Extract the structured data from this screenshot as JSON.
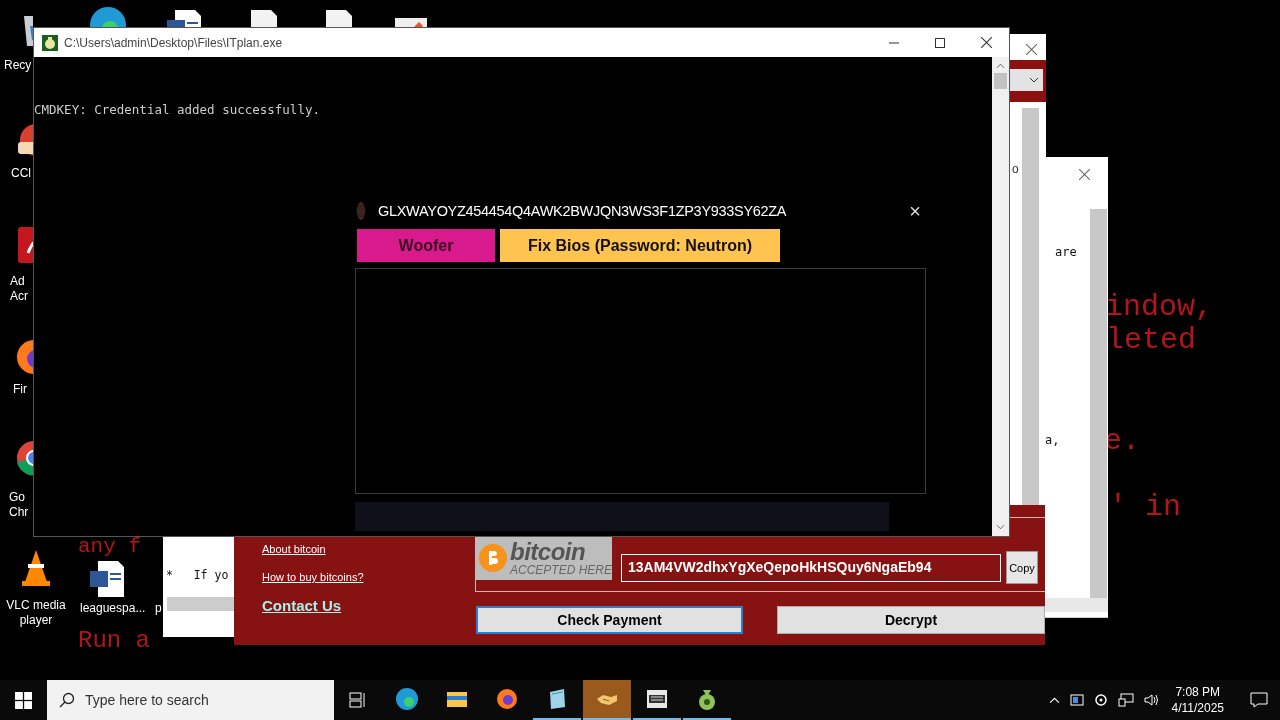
{
  "wallpaper_text": [
    "indow,",
    "leted",
    "e.",
    "' in",
    "any f",
    "Run a"
  ],
  "desktop_icons": [
    {
      "kind": "recycle",
      "lines": [
        "Recy"
      ]
    },
    {
      "kind": "ccleaner",
      "lines": [
        "CCl"
      ]
    },
    {
      "kind": "acrobat",
      "lines": [
        "Ad",
        "Acr"
      ]
    },
    {
      "kind": "firefox",
      "lines": [
        "Fir"
      ]
    },
    {
      "kind": "chrome",
      "lines": [
        "Go",
        "Chr"
      ]
    },
    {
      "kind": "vlc",
      "lines": [
        "VLC media",
        "player"
      ]
    },
    {
      "kind": "word",
      "lines": [
        "leaguespa..."
      ]
    },
    {
      "kind": "blank",
      "lines": [
        "p"
      ]
    },
    {
      "kind": "edge"
    },
    {
      "kind": "word"
    },
    {
      "kind": "doc"
    },
    {
      "kind": "doc"
    },
    {
      "kind": "image"
    }
  ],
  "back_window_1": {
    "text": "o"
  },
  "back_window_2": {
    "text_1": "are",
    "text_2": "a,"
  },
  "text_window": {
    "text": "*   If yo"
  },
  "ransom_window": {
    "links": [
      "About bitcoin",
      "How to buy bitcoins?"
    ],
    "contact": "Contact Us",
    "badge": {
      "word": "bitcoin",
      "caption": "ACCEPTED HERE"
    },
    "address": "13AM4VW2dhxYgXeQepoHkHSQuy6NgaEb94",
    "copy_button": "Copy",
    "buttons": [
      {
        "label": "Check Payment",
        "focused": true
      },
      {
        "label": "Decrypt",
        "focused": false
      }
    ]
  },
  "console": {
    "title": "C:\\Users\\admin\\Desktop\\Files\\ITplan.exe",
    "output": "CMDKEY: Credential added successfully."
  },
  "overlay": {
    "id": "GLXWAYOYZ454454Q4AWK2BWJQN3WS3F1ZP3Y933SY62ZA",
    "close": "×",
    "buttons": [
      {
        "label": "Woofer",
        "color": "#d91a8c"
      },
      {
        "label": "Fix Bios (Password: Neutron)",
        "color": "#ffc34f"
      }
    ]
  },
  "taskbar": {
    "search_placeholder": "Type here to search",
    "apps": [
      {
        "kind": "edge",
        "running": false,
        "selected": false
      },
      {
        "kind": "explorer",
        "running": false,
        "selected": false
      },
      {
        "kind": "firefox",
        "running": false,
        "selected": false
      },
      {
        "kind": "notepad",
        "running": true,
        "selected": false
      },
      {
        "kind": "handshake",
        "running": true,
        "selected": true
      },
      {
        "kind": "box",
        "running": true,
        "selected": false
      },
      {
        "kind": "moneybag",
        "running": true,
        "selected": false
      }
    ],
    "time": "7:08 PM",
    "date": "4/11/2025"
  }
}
